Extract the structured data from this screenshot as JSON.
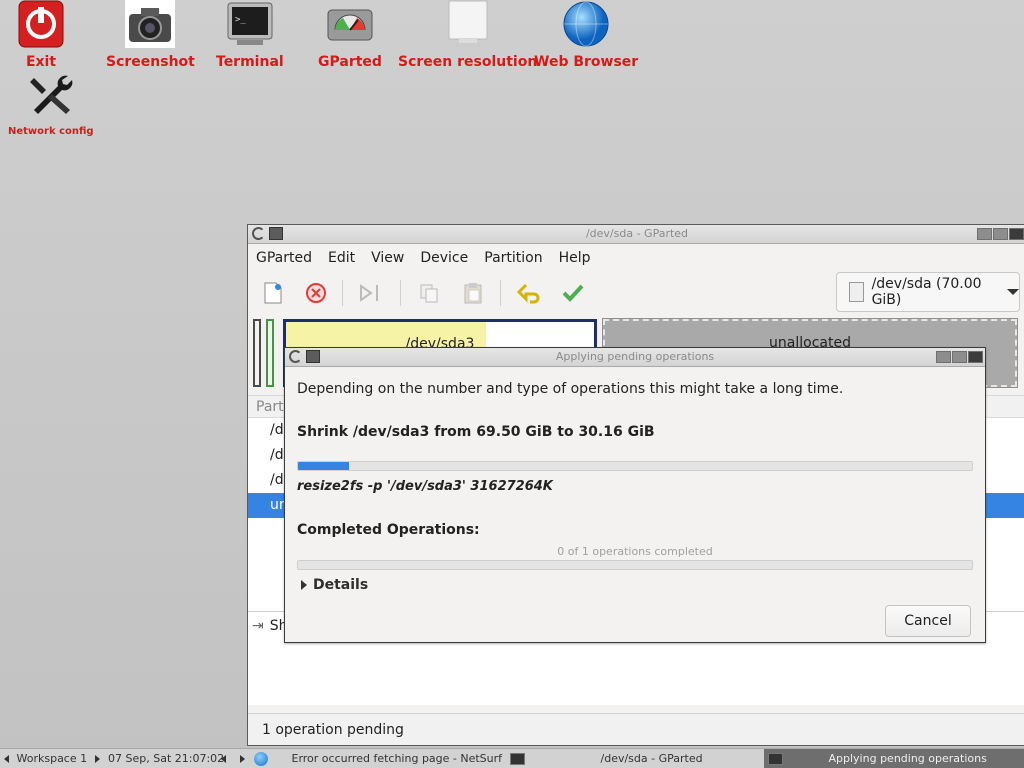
{
  "desktop": {
    "icons": [
      {
        "label": "Exit",
        "icon": "power-icon"
      },
      {
        "label": "Screenshot",
        "icon": "camera-icon"
      },
      {
        "label": "Terminal",
        "icon": "terminal-icon"
      },
      {
        "label": "GParted",
        "icon": "disk-gauge-icon"
      },
      {
        "label": "Screen resolution",
        "icon": "monitor-icon"
      },
      {
        "label": "Web Browser",
        "icon": "globe-icon"
      },
      {
        "label": "Network config",
        "icon": "wrench-icon"
      }
    ]
  },
  "gparted": {
    "title": "/dev/sda - GParted",
    "menu": [
      "GParted",
      "Edit",
      "View",
      "Device",
      "Partition",
      "Help"
    ],
    "device": "/dev/sda (70.00 GiB)",
    "partitions": {
      "sda3_label": "/dev/sda3",
      "unallocated_label": "unallocated"
    },
    "list": {
      "header": "Part",
      "rows": [
        "/d",
        "/d",
        "/d",
        "ur"
      ]
    },
    "op_panel_item": "Sh",
    "status": "1 operation pending"
  },
  "dialog": {
    "title": "Applying pending operations",
    "intro": "Depending on the number and type of operations this might take a long time.",
    "current_op": "Shrink /dev/sda3 from 69.50 GiB to 30.16 GiB",
    "progress_fraction": 0.075,
    "command": "resize2fs -p '/dev/sda3' 31627264K",
    "completed_heading": "Completed Operations:",
    "completed_text": "0 of 1 operations completed",
    "completed_fraction": 0,
    "details_label": "Details",
    "cancel_label": "Cancel"
  },
  "taskbar": {
    "workspace": "Workspace 1",
    "clock": "07 Sep, Sat 21:07:02",
    "tasks": [
      "Error occurred fetching page - NetSurf",
      "/dev/sda - GParted",
      "Applying pending operations"
    ]
  },
  "colors": {
    "desktop_label": "#d61a1a",
    "progress": "#3584e4",
    "selection": "#3584e4",
    "used_space": "#f6f3a7",
    "partition_border": "#1f2d6b"
  }
}
